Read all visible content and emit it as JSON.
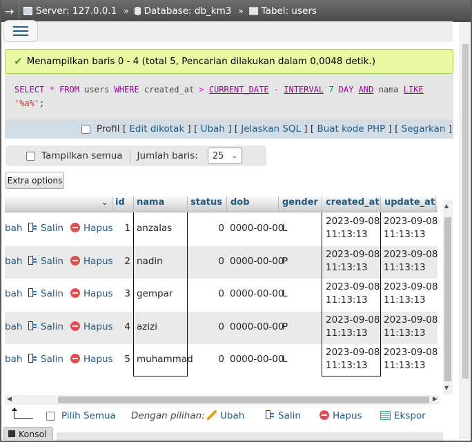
{
  "breadcrumb": {
    "server": "Server: 127.0.0.1",
    "database": "Database: db_km3",
    "table": "Tabel: users",
    "separator": "»"
  },
  "notice": {
    "message": "Menampilkan baris 0 - 4 (total 5, Pencarian dilakukan dalam 0,0048 detik.)"
  },
  "sql": {
    "t1": "SELECT",
    "t2": "*",
    "t3": "FROM",
    "t4": "users",
    "t5": "WHERE",
    "t6": "created_at",
    "t7": ">",
    "t8": "CURRENT_DATE",
    "t9": "-",
    "t10": "INTERVAL",
    "t11": "7",
    "t12": "DAY",
    "t13": "AND",
    "t14": "nama",
    "t15": "LIKE",
    "t16": "'%a%'",
    "t17": ";"
  },
  "sql_links": {
    "profil": "Profil",
    "edit_inline": "Edit dikotak",
    "edit": "Ubah",
    "explain": "Jelaskan SQL",
    "create_php": "Buat kode PHP",
    "refresh": "Segarkan"
  },
  "display": {
    "show_all": "Tampilkan semua",
    "rows_label": "Jumlah baris:",
    "rows_value": "25",
    "extra_options": "Extra options"
  },
  "table": {
    "headers": [
      "id",
      "nama",
      "status",
      "dob",
      "gender",
      "created_at",
      "update_at"
    ],
    "actions": {
      "edit": "bah",
      "copy": "Salin",
      "delete": "Hapus"
    },
    "rows": [
      {
        "id": "1",
        "nama": "anzalas",
        "status": "0",
        "dob": "0000-00-00",
        "gender": "L",
        "created_date": "2023-09-08",
        "created_time": "11:13:13",
        "update_date": "2023-09-08",
        "update_time": "11:13:13"
      },
      {
        "id": "2",
        "nama": "nadin",
        "status": "0",
        "dob": "0000-00-00",
        "gender": "P",
        "created_date": "2023-09-08",
        "created_time": "11:13:13",
        "update_date": "2023-09-08",
        "update_time": "11:13:13"
      },
      {
        "id": "3",
        "nama": "gempar",
        "status": "0",
        "dob": "0000-00-00",
        "gender": "L",
        "created_date": "2023-09-08",
        "created_time": "11:13:13",
        "update_date": "2023-09-08",
        "update_time": "11:13:13"
      },
      {
        "id": "4",
        "nama": "azizi",
        "status": "0",
        "dob": "0000-00-00",
        "gender": "P",
        "created_date": "2023-09-08",
        "created_time": "11:13:13",
        "update_date": "2023-09-08",
        "update_time": "11:13:13"
      },
      {
        "id": "5",
        "nama": "muhammad",
        "status": "0",
        "dob": "0000-00-00",
        "gender": "L",
        "created_date": "2023-09-08",
        "created_time": "11:13:13",
        "update_date": "2023-09-08",
        "update_time": "11:13:13"
      }
    ]
  },
  "bulk": {
    "check_all": "Pilih Semua",
    "with_selected": "Dengan pilihan:",
    "edit": "Ubah",
    "copy": "Salin",
    "delete": "Hapus",
    "export": "Ekspor"
  },
  "console": {
    "label": "Konsol"
  },
  "colors": {
    "link": "#235a81",
    "notice_bg": "#ebf8a4",
    "sql_links_bg": "#d2dde6",
    "delete": "#e04f4f"
  }
}
